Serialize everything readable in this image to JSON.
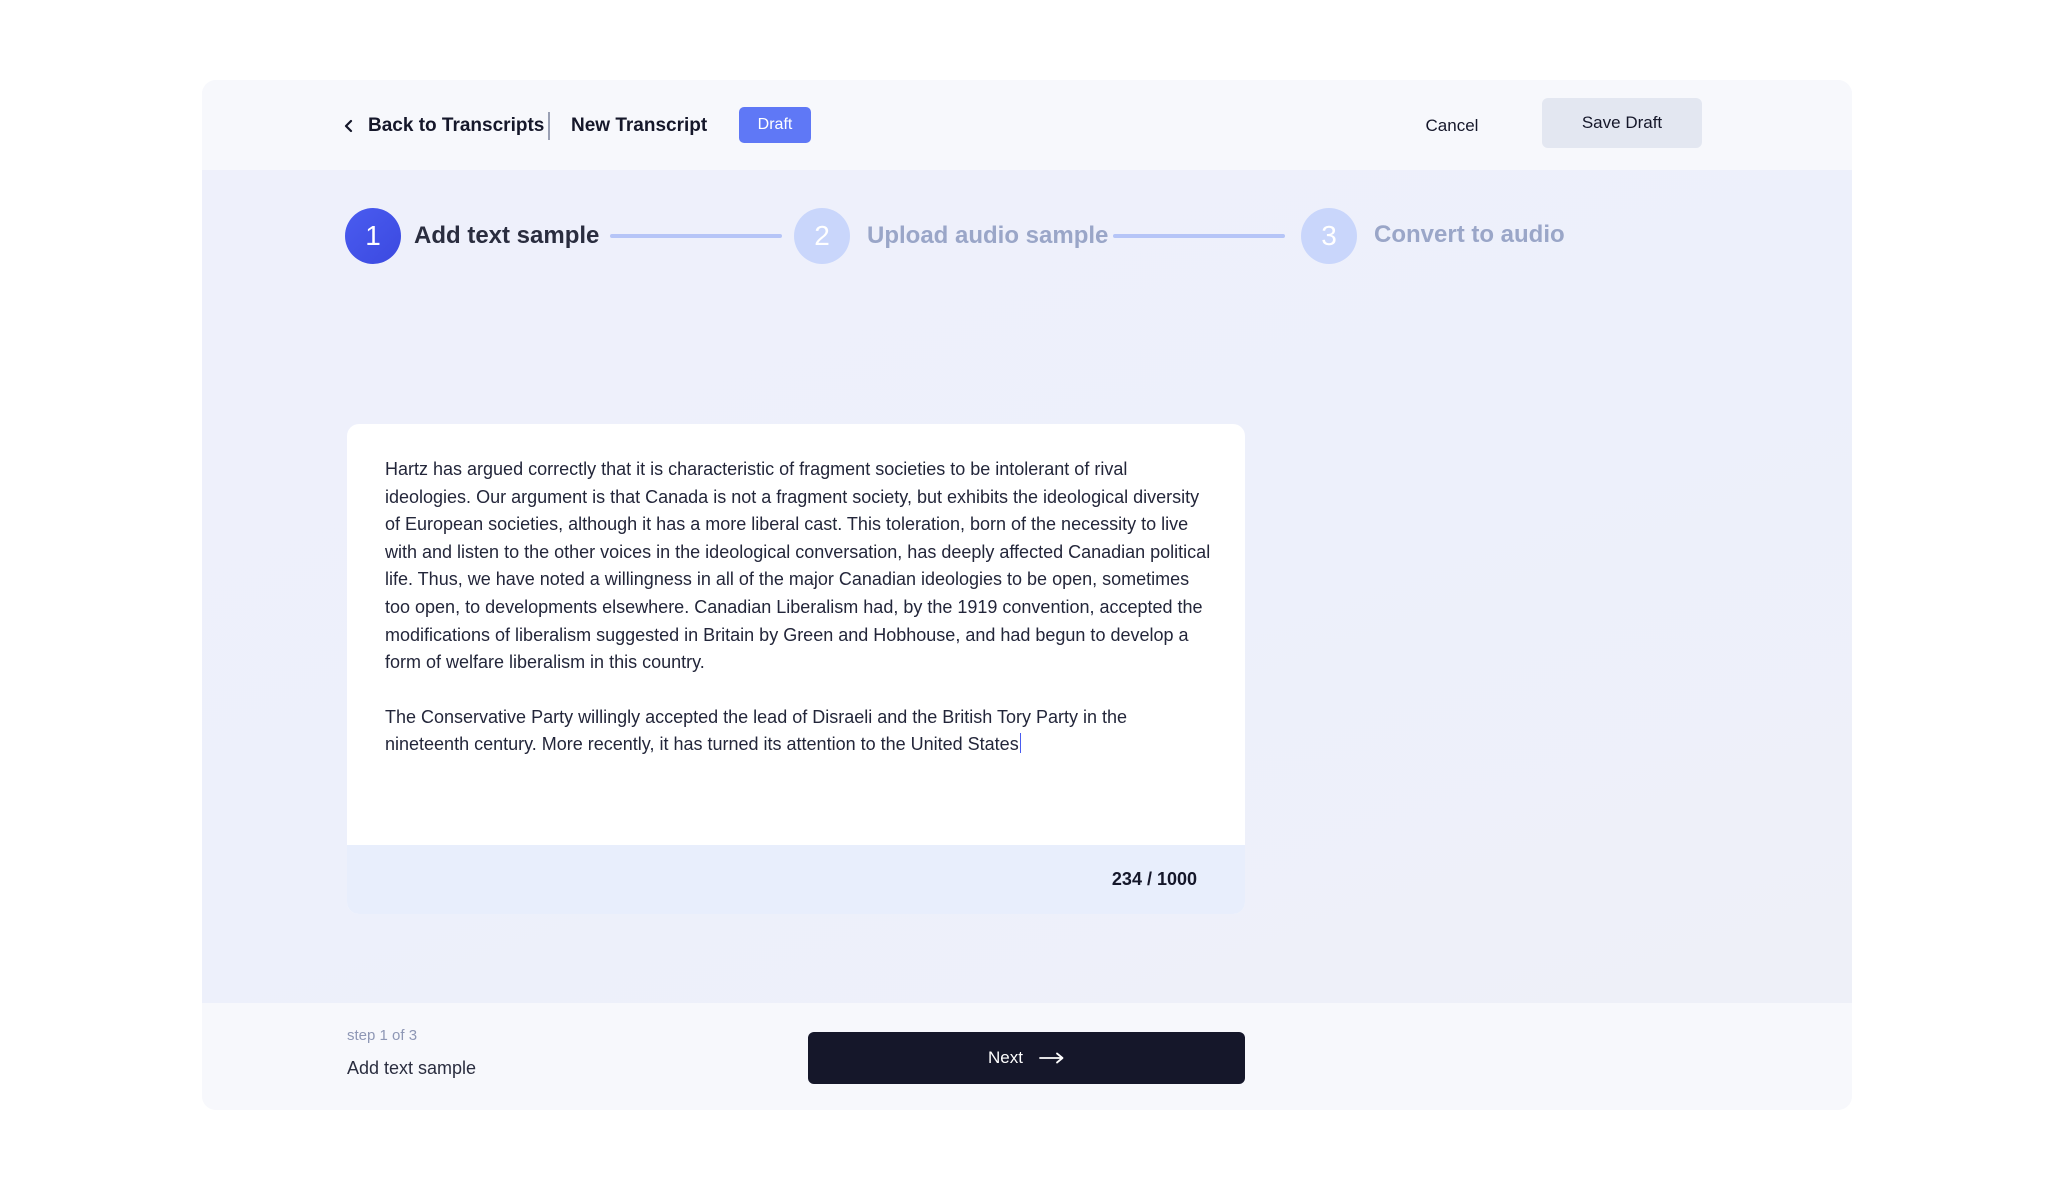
{
  "header": {
    "back_label": "Back to Transcripts",
    "page_title": "New Transcript",
    "badge": "Draft",
    "cancel_label": "Cancel",
    "save_label": "Save Draft"
  },
  "stepper": {
    "steps": [
      {
        "number": "1",
        "label": "Add text sample",
        "state": "active"
      },
      {
        "number": "2",
        "label": "Upload audio sample",
        "state": "inactive"
      },
      {
        "number": "3",
        "label": "Convert to audio",
        "state": "inactive"
      }
    ]
  },
  "editor": {
    "paragraphs": [
      "Hartz has argued correctly that it is characteristic of fragment societies to be intolerant of rival ideologies. Our argument is that Canada is not a fragment society, but exhibits the ideological diversity of European societies, although it has a more liberal cast. This toleration, born of the necessity to live with and listen to the other voices in the ideological conversation, has deeply affected Canadian political life. Thus, we have noted a willingness in all of the major Canadian ideologies to be open, sometimes too open, to developments elsewhere. Canadian Liberalism had, by the 1919 convention, accepted the modifications of liberalism suggested in Britain by Green and Hobhouse, and had begun to develop a form of welfare liberalism in this country.",
      "The Conservative Party willingly accepted the lead of Disraeli and the British Tory Party in the nineteenth century. More recently, it has turned its attention to the United States"
    ],
    "counter": "234 / 1000"
  },
  "footer": {
    "step_count": "step 1 of 3",
    "step_name": "Add text sample",
    "next_label": "Next"
  },
  "colors": {
    "accent": "#4a5cf0",
    "badge": "#5f78f6",
    "dark": "#15172a",
    "inactive_step": "#c9d6fb"
  },
  "icons": {
    "back": "chevron-left-icon",
    "next": "arrow-right-icon"
  }
}
